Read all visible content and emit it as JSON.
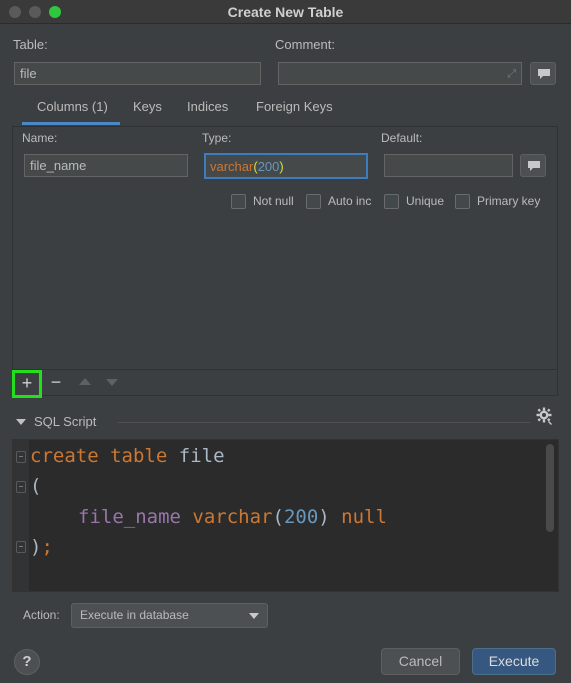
{
  "window": {
    "title": "Create New Table"
  },
  "table_section": {
    "table_label": "Table:",
    "table_value": "file",
    "comment_label": "Comment:",
    "comment_value": ""
  },
  "tabs": [
    {
      "label": "Columns (1)",
      "selected": true
    },
    {
      "label": "Keys",
      "selected": false
    },
    {
      "label": "Indices",
      "selected": false
    },
    {
      "label": "Foreign Keys",
      "selected": false
    }
  ],
  "column_editor": {
    "name_label": "Name:",
    "name_value": "file_name",
    "type_label": "Type:",
    "type_name": "varchar",
    "type_paren_open": "(",
    "type_size": "200",
    "type_paren_close": ")",
    "default_label": "Default:",
    "default_value": "",
    "checkboxes": [
      {
        "label": "Not null",
        "checked": false
      },
      {
        "label": "Auto inc",
        "checked": false
      },
      {
        "label": "Unique",
        "checked": false
      },
      {
        "label": "Primary key",
        "checked": false
      }
    ]
  },
  "toolbar": {
    "add_symbol": "+",
    "remove_symbol": "−"
  },
  "sql_script": {
    "title": "SQL Script",
    "line1_kw1": "create",
    "line1_kw2": "table",
    "line1_name": "file",
    "line2": "(",
    "line3_col": "file_name",
    "line3_type": "varchar",
    "line3_open": "(",
    "line3_num": "200",
    "line3_close": ")",
    "line3_null": "null",
    "line4_paren": ")",
    "line4_semi": ";"
  },
  "action": {
    "label": "Action:",
    "selected": "Execute in database"
  },
  "buttons": {
    "help": "?",
    "cancel": "Cancel",
    "execute": "Execute"
  },
  "colors": {
    "keyword": "#cc7832",
    "column": "#9876aa",
    "number": "#6897bb",
    "accent": "#4a88c7",
    "highlight": "#22e01a"
  }
}
